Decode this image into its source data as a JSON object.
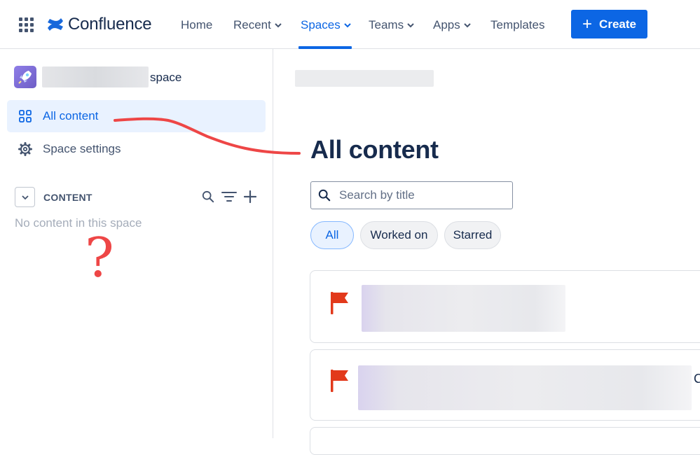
{
  "topnav": {
    "brand_name": "Confluence",
    "items": [
      {
        "label": "Home",
        "has_dropdown": false
      },
      {
        "label": "Recent",
        "has_dropdown": true
      },
      {
        "label": "Spaces",
        "has_dropdown": true,
        "active": true
      },
      {
        "label": "Teams",
        "has_dropdown": true
      },
      {
        "label": "Apps",
        "has_dropdown": true
      },
      {
        "label": "Templates",
        "has_dropdown": false
      }
    ],
    "create_label": "Create",
    "icons": [
      "app-switcher-icon",
      "confluence-logo-icon",
      "chevron-down-icon",
      "plus-icon"
    ]
  },
  "sidebar": {
    "space_name_suffix": "space",
    "items": [
      {
        "label": "All content",
        "icon": "grid-icon",
        "selected": true
      },
      {
        "label": "Space settings",
        "icon": "gear-icon",
        "selected": false
      }
    ],
    "content_section": {
      "heading": "CONTENT",
      "empty_message": "No content in this space",
      "actions": [
        "search-icon",
        "filter-icon",
        "plus-icon"
      ]
    }
  },
  "main": {
    "title": "All content",
    "search": {
      "placeholder": "Search by title",
      "value": ""
    },
    "filters": [
      {
        "label": "All",
        "active": true
      },
      {
        "label": "Worked on",
        "active": false
      },
      {
        "label": "Starred",
        "active": false
      }
    ],
    "cards": [
      {
        "icon": "flag-icon",
        "trailing_text": ""
      },
      {
        "icon": "flag-icon",
        "trailing_text": "C"
      }
    ]
  },
  "annotations": {
    "question_mark": "?",
    "color": "#ee4646"
  },
  "colors": {
    "accent": "#0c66e4",
    "selected_bg": "#e9f2ff",
    "flag": "#e2391b",
    "text": "#172b4d",
    "subtle_text": "#44546f"
  }
}
